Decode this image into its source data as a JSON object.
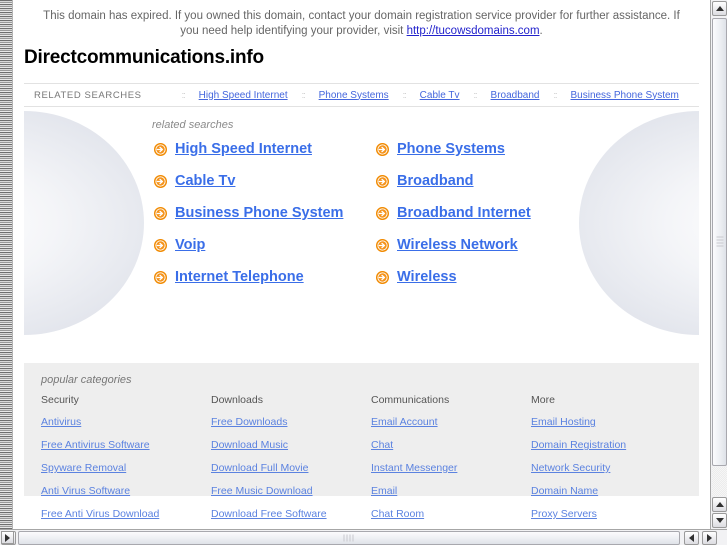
{
  "banner": {
    "text_before": "This domain has expired. If you owned this domain, contact your domain registration service provider for further assistance. If you need help identifying your provider, visit ",
    "link_text": "http://tucowsdomains.com",
    "text_after": "."
  },
  "domain_title": "Directcommunications.info",
  "related_bar": {
    "label": "RELATED SEARCHES",
    "separator": "::",
    "links": [
      "High Speed Internet",
      "Phone Systems",
      "Cable Tv",
      "Broadband",
      "Business Phone System"
    ]
  },
  "main": {
    "heading": "related searches",
    "links": [
      "High Speed Internet",
      "Phone Systems",
      "Cable Tv",
      "Broadband",
      "Business Phone System",
      "Broadband Internet",
      "Voip",
      "Wireless Network",
      "Internet Telephone",
      "Wireless"
    ]
  },
  "categories": {
    "title": "popular categories",
    "columns": [
      {
        "heading": "Security",
        "links": [
          "Antivirus",
          "Free Antivirus Software",
          "Spyware Removal",
          "Anti Virus Software",
          "Free Anti Virus Download"
        ]
      },
      {
        "heading": "Downloads",
        "links": [
          "Free Downloads",
          "Download Music",
          "Download Full Movie",
          "Free Music Download",
          "Download Free Software"
        ]
      },
      {
        "heading": "Communications",
        "links": [
          "Email Account",
          "Chat",
          "Instant Messenger",
          "Email",
          "Chat Room"
        ]
      },
      {
        "heading": "More",
        "links": [
          "Email Hosting",
          "Domain Registration",
          "Network Security",
          "Domain Name",
          "Proxy Servers"
        ]
      }
    ]
  },
  "colors": {
    "link_blue": "#3a6ee8",
    "arrow_orange": "#f18a00",
    "category_bg": "#eeeeee"
  }
}
